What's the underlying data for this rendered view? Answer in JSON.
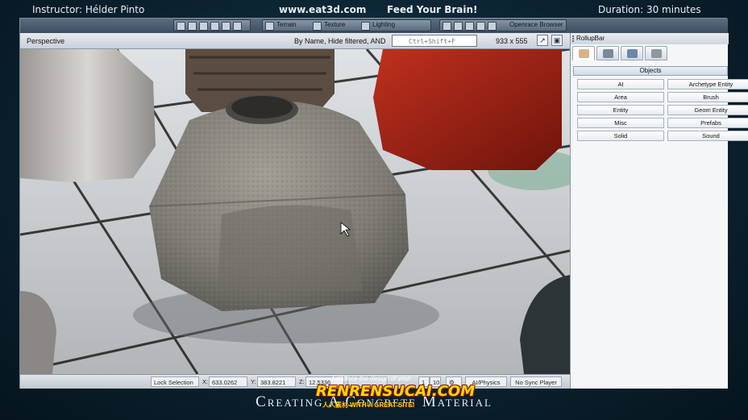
{
  "banner": {
    "instructor": "Instructor: Hélder Pinto",
    "site": "www.eat3d.com",
    "slogan": "Feed Your Brain!",
    "duration": "Duration: 30 minutes"
  },
  "toolbar": {
    "terrain_label": "Terrain",
    "texture_label": "Texture",
    "lighting_label": "Lighting",
    "browser_label": "Openrace Browser"
  },
  "viewport": {
    "title": "Perspective",
    "filter_label": "By Name, Hide filtered, AND",
    "search_placeholder": "Ctrl+Shift+F",
    "resolution": "933 x 555"
  },
  "rollup": {
    "title": "RollupBar",
    "section_title": "Objects",
    "objects": [
      "AI",
      "Archetype Entity",
      "Area",
      "Brush",
      "Entity",
      "Geom Entity",
      "Misc",
      "Prefabs",
      "Solid",
      "Sound"
    ]
  },
  "statusbar": {
    "lock_selection": "Lock Selection",
    "x_label": "X:",
    "x_value": "633.0262",
    "y_label": "Y:",
    "y_value": "383.8221",
    "z_label": "Z:",
    "z_value": "12.5336",
    "snap_1": "1",
    "snap_10": "10",
    "ai_physics": "AI/Physics",
    "sync_player": "No Sync Player"
  },
  "caption": "Creating A Concrete Material",
  "watermark": {
    "top": "Enhance the design of your",
    "main": "RENRENSUCAI.COM",
    "bottom": "人人素材 WITH A GREAT SITE!"
  },
  "colors": {
    "background": "#0b2331",
    "concrete": "#8c8a84",
    "red_object": "#a02014",
    "panel": "#f4f6f8"
  }
}
